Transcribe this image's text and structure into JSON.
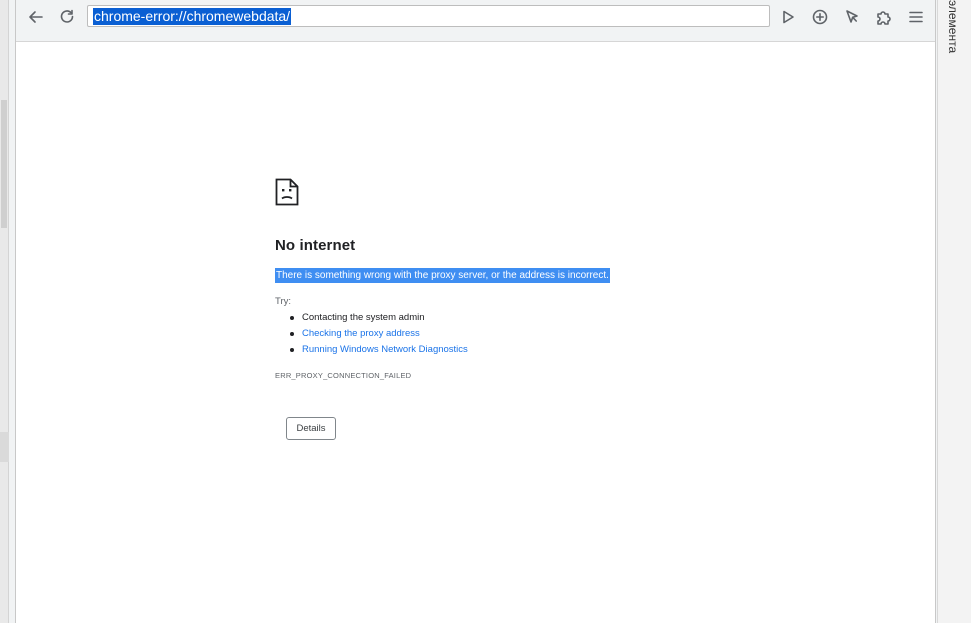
{
  "toolbar": {
    "back_icon": "arrow-left-icon",
    "reload_icon": "reload-icon",
    "address": "chrome-error://chromewebdata/",
    "play_icon": "play-icon",
    "add_icon": "plus-circle-icon",
    "cursor_icon": "cursor-icon",
    "extensions_icon": "puzzle-icon",
    "menu_icon": "hamburger-menu-icon"
  },
  "right_panel": {
    "label": "элемента"
  },
  "error": {
    "icon": "sad-page-icon",
    "title": "No internet",
    "message": "There is something wrong with the proxy server, or the address is incorrect.",
    "try_label": "Try:",
    "suggestions": [
      {
        "text": "Contacting the system admin",
        "link": false
      },
      {
        "text": "Checking the proxy address",
        "link": true
      },
      {
        "text": "Running Windows Network Diagnostics",
        "link": true
      }
    ],
    "code": "ERR_PROXY_CONNECTION_FAILED",
    "details_label": "Details"
  },
  "colors": {
    "selection": "#0a5fd3",
    "message_highlight": "#3f8ef2",
    "link": "#1a73e8"
  }
}
